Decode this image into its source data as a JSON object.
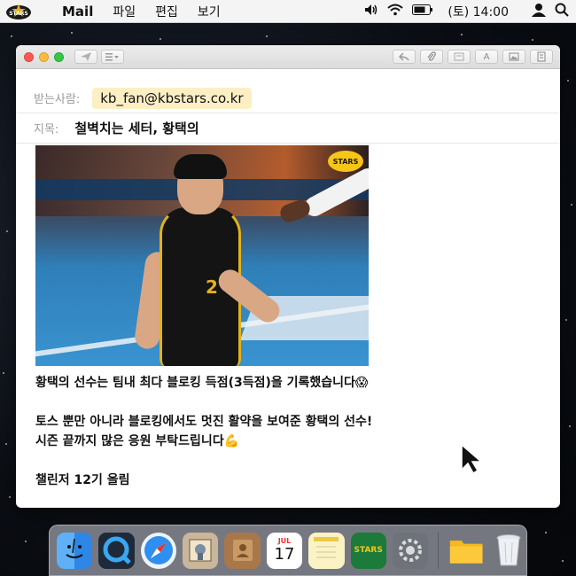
{
  "menubar": {
    "app_name": "Mail",
    "menus": [
      "파일",
      "편집",
      "보기"
    ],
    "clock": "(토) 14:00",
    "logo_text": "STARS"
  },
  "mail": {
    "to_label": "받는사람:",
    "to_value": "kb_fan@kbstars.co.kr",
    "subject_label": "지목:",
    "subject_value": "철벽치는 세터, 황택의",
    "photo": {
      "jersey_number": "2",
      "badge_text": "STARS"
    },
    "body": {
      "line1": "황택의 선수는 팀내 최다 블로킹 득점(3득점)을 기록했습니다😱",
      "line2": "토스 뿐만 아니라 블로킹에서도 멋진 활약을 보여준 황택의 선수!",
      "line3": "시즌 끝까지 많은 응원 부탁드립니다💪",
      "signature": "챌린저 12기 올림"
    }
  },
  "toolbar": {
    "format_label": "A"
  },
  "dock": {
    "calendar_month": "JUL",
    "calendar_day": "17",
    "stars_label": "STARS"
  },
  "colors": {
    "chip_bg": "#fcefc4",
    "window_red": "#fc5753",
    "window_yellow": "#fdbc40",
    "window_green": "#33c748",
    "team_gold": "#e3b21b"
  }
}
